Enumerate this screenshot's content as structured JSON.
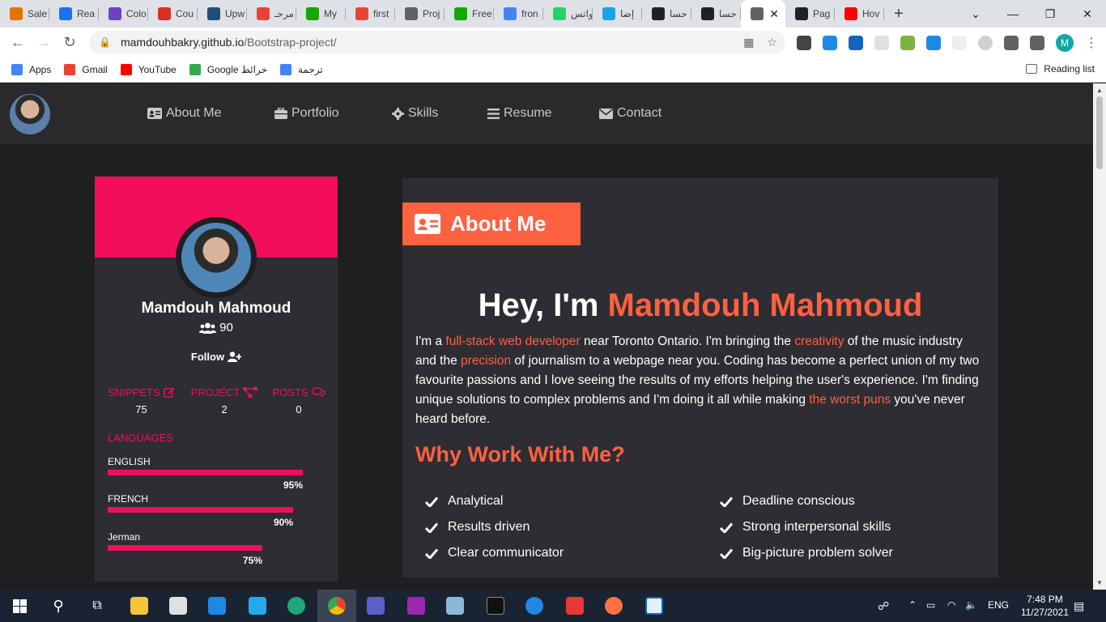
{
  "browser": {
    "tabs": [
      {
        "label": "Sale",
        "color": "#e37400"
      },
      {
        "label": "Rea",
        "color": "#1a73e8"
      },
      {
        "label": "Colo",
        "color": "#6f42c1"
      },
      {
        "label": "Cou",
        "color": "#d93025"
      },
      {
        "label": "Upw",
        "color": "#1f4e79"
      },
      {
        "label": "مرحـ",
        "color": "#ea4335"
      },
      {
        "label": "My",
        "color": "#14a800"
      },
      {
        "label": "first",
        "color": "#ea4335"
      },
      {
        "label": "Proj",
        "color": "#5f6368"
      },
      {
        "label": "Free",
        "color": "#14a800"
      },
      {
        "label": "fron",
        "color": "#4285f4"
      },
      {
        "label": "واتس",
        "color": "#25d366"
      },
      {
        "label": "إضا",
        "color": "#1aa3e8"
      },
      {
        "label": "حسا",
        "color": "#202124"
      },
      {
        "label": "حسا",
        "color": "#202124"
      }
    ],
    "active_tab": {
      "label": "",
      "color": "#5f6368"
    },
    "tabs_after": [
      {
        "label": "Pag",
        "color": "#202124"
      },
      {
        "label": "Hov",
        "color": "#ff0000"
      }
    ],
    "new_tab": "+",
    "url_host": "mamdouhbakry.github.io",
    "url_path": "/Bootstrap-project/",
    "profile_initial": "M",
    "bookmarks": [
      {
        "label": "Apps",
        "color": "#4285f4"
      },
      {
        "label": "Gmail",
        "color": "#ea4335"
      },
      {
        "label": "YouTube",
        "color": "#ff0000"
      },
      {
        "label": "Google خرائط",
        "color": "#34a853"
      },
      {
        "label": "ترجمة",
        "color": "#4285f4"
      }
    ],
    "reading_list": "Reading list"
  },
  "nav": {
    "about": "About Me",
    "portfolio": "Portfolio",
    "skills": "Skills",
    "resume": "Resume",
    "contact": "Contact"
  },
  "profile": {
    "name": "Mamdouh Mahmoud",
    "followers": "90",
    "follow": "Follow",
    "stats": [
      {
        "label": "SNIPPETS",
        "value": "75"
      },
      {
        "label": "PROJECT",
        "value": "2"
      },
      {
        "label": "POSTS",
        "value": "0"
      }
    ],
    "languages_title": "LANGUAGES",
    "languages": [
      {
        "name": "ENGLISH",
        "percent": 95,
        "label": "95%"
      },
      {
        "name": "FRENCH",
        "percent": 90,
        "label": "90%"
      },
      {
        "name": "Jerman",
        "percent": 75,
        "label": "75%"
      }
    ]
  },
  "about": {
    "tag": "About Me",
    "hey_prefix": "Hey, I'm ",
    "hey_name": "Mamdouh Mahmoud",
    "bio": {
      "p1": "I'm a ",
      "h1": "full-stack web developer",
      "p2": " near Toronto Ontario. I'm bringing the ",
      "h2": "creativity",
      "p3": " of the music industry and the ",
      "h3": "precision",
      "p4": " of journalism to a webpage near you. Coding has become a perfect union of my two favourite passions and I love seeing the results of my efforts helping the user's experience. I'm finding unique solutions to complex problems and I'm doing it all while making ",
      "h4": "the worst puns",
      "p5": " you've never heard before."
    },
    "why_title": "Why Work With Me?",
    "qualities_left": [
      "Analytical",
      "Results driven",
      "Clear communicator"
    ],
    "qualities_right": [
      "Deadline conscious",
      "Strong interpersonal skills",
      "Big-picture problem solver"
    ]
  },
  "taskbar": {
    "lang": "ENG",
    "time": "7:48 PM",
    "date": "11/27/2021"
  },
  "colors": {
    "accent_pink": "#f20e5b",
    "accent_orange": "#fd6140",
    "card_bg": "#2d2d33",
    "page_bg": "#1f1f22"
  }
}
